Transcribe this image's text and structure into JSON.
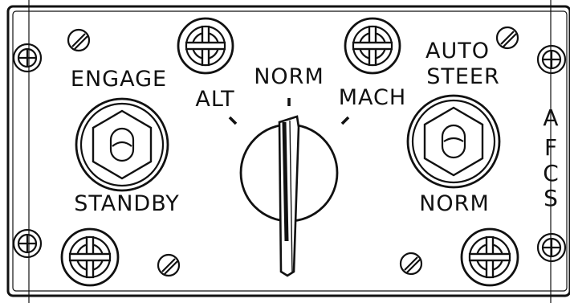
{
  "panel": {
    "toggle_left": {
      "top_label": "ENGAGE",
      "bottom_label": "STANDBY"
    },
    "toggle_right": {
      "top_label": [
        "AUTO",
        "STEER"
      ],
      "bottom_label": "NORM"
    },
    "selector": {
      "positions": [
        "ALT",
        "NORM",
        "MACH"
      ],
      "selected": "NORM"
    },
    "side_label": [
      "A",
      "F",
      "C",
      "S"
    ]
  },
  "style": {
    "ink": "#111111",
    "paper": "#ffffff"
  }
}
